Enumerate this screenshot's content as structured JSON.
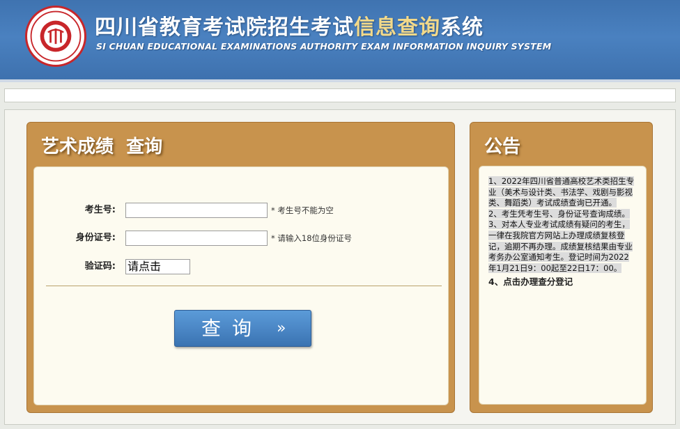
{
  "header": {
    "title_part1": "四川省教育考试院招生考试",
    "title_highlight": "信息查询",
    "title_part2": "系统",
    "subtitle": "SI CHUAN EDUCATIONAL EXAMINATIONS AUTHORITY EXAM INFORMATION INQUIRY SYSTEM",
    "logo_icon": "authority-seal-icon",
    "colors": {
      "header_blue": "#4a81c0",
      "highlight_gold": "#f2d98a",
      "seal_red": "#c8262a"
    }
  },
  "query_panel": {
    "title": "艺术成绩  查询",
    "exam_no_label": "考生号:",
    "exam_no_value": "",
    "exam_no_hint": "* 考生号不能为空",
    "id_label": "身份证号:",
    "id_value": "",
    "id_hint": "* 请输入18位身份证号",
    "captcha_label": "验证码:",
    "captcha_text": "请点击",
    "submit_label": "查询",
    "submit_arrow": "»",
    "colors": {
      "panel_brown": "#c8934d",
      "button_blue": "#4b87c6"
    }
  },
  "notice_panel": {
    "title": "公告",
    "item1": "1、2022年四川省普通高校艺术类招生专业（美术与设计类、书法学、戏剧与影视类、舞蹈类）考试成绩查询已开通。",
    "item2": "2、考生凭考生号、身份证号查询成绩。",
    "item3": "3、对本人专业考试成绩有疑问的考生，一律在我院官方网站上办理成绩复核登记，逾期不再办理。成绩复核结果由专业考务办公室通知考生。登记时间为2022年1月21日9：00起至22日17：00。",
    "item4": "4、点击办理查分登记"
  }
}
